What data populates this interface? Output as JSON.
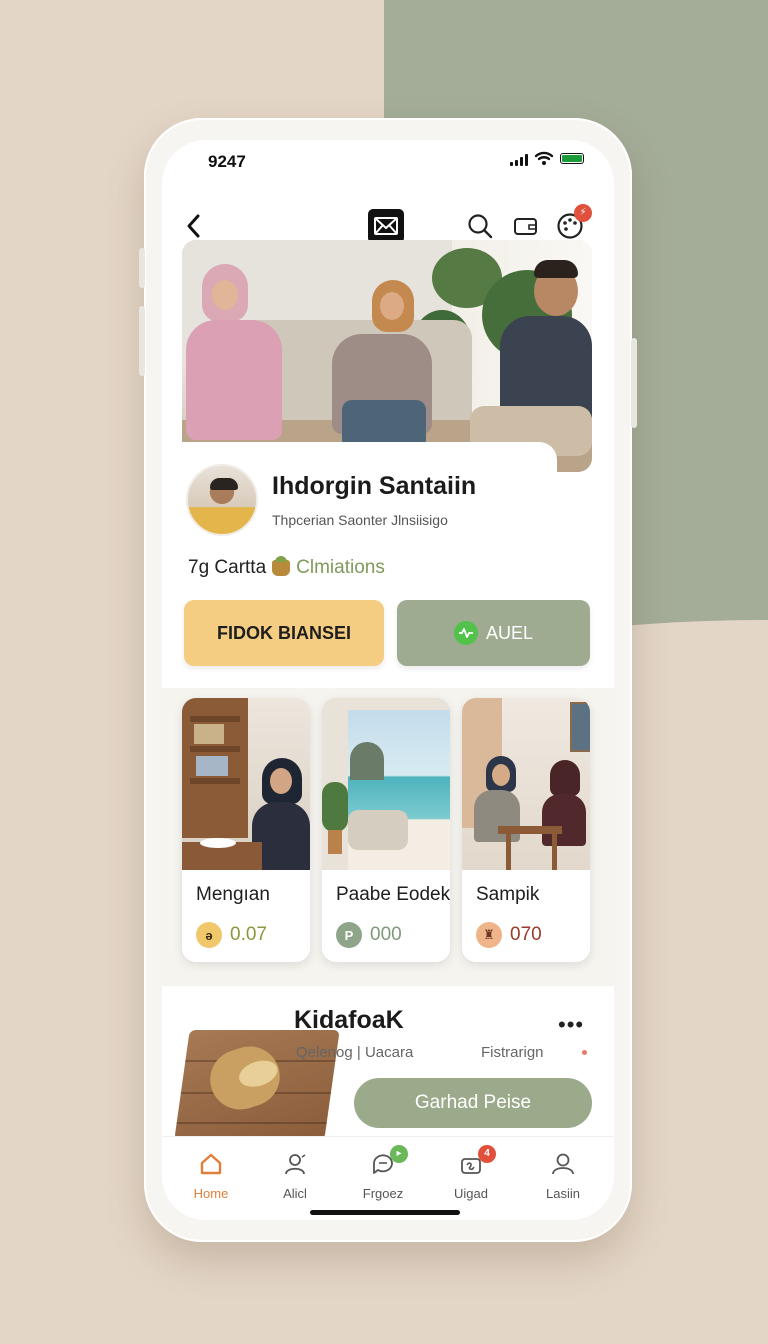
{
  "status_bar": {
    "time": "9247"
  },
  "colors": {
    "background": "#e4d6c6",
    "sage": "#a4ad98",
    "primary_button": "#f4cd82",
    "secondary_button": "#9eab90",
    "accent_green": "#7f9a5a",
    "tab_active": "#e07f3c",
    "badge_red": "#e0503b"
  },
  "header": {
    "back_icon": "chevron-left-icon",
    "logo_icon": "envelope-logo-icon",
    "icons": [
      "search-icon",
      "wallet-icon",
      "palette-icon"
    ],
    "notification_badge": "⚡"
  },
  "profile": {
    "name": "Ihdorgin Santaiin",
    "subtitle": "Thpcerian Saonter Jlnsiisigo"
  },
  "stats": {
    "count_label": "7g Cartta",
    "highlight": "Clmiations"
  },
  "actions": {
    "primary_label": "FIDOK BIANSEI",
    "secondary_label": "AUEL"
  },
  "cards": [
    {
      "title": "Mengıan",
      "value": "0.07",
      "value_color": "#8a9a3a",
      "chip": "ə",
      "chip_bg": "#f1c76b"
    },
    {
      "title": "Paabe Eodek",
      "value": "000",
      "value_color": "#7f9a7a",
      "chip": "P",
      "chip_bg": "#8fa58a"
    },
    {
      "title": "Sampik",
      "value": "070",
      "value_color": "#9a3a2a",
      "chip": "♜",
      "chip_bg": "#f0b48a"
    }
  ],
  "feature": {
    "title": "KidafoaK",
    "subtitle": "Qelenog | Uacara",
    "side_label": "Fistrarign",
    "more": "•••",
    "cta_label": "Garhad Peise"
  },
  "tabs": [
    {
      "label": "Home",
      "icon": "home-icon",
      "active": true
    },
    {
      "label": "Alicl",
      "icon": "users-icon",
      "active": false
    },
    {
      "label": "Frgoez",
      "icon": "chat-icon",
      "active": false,
      "badge": "▸"
    },
    {
      "label": "Uigad",
      "icon": "gift-icon",
      "active": false,
      "badge": "4"
    },
    {
      "label": "Lasiin",
      "icon": "profile-icon",
      "active": false
    }
  ]
}
